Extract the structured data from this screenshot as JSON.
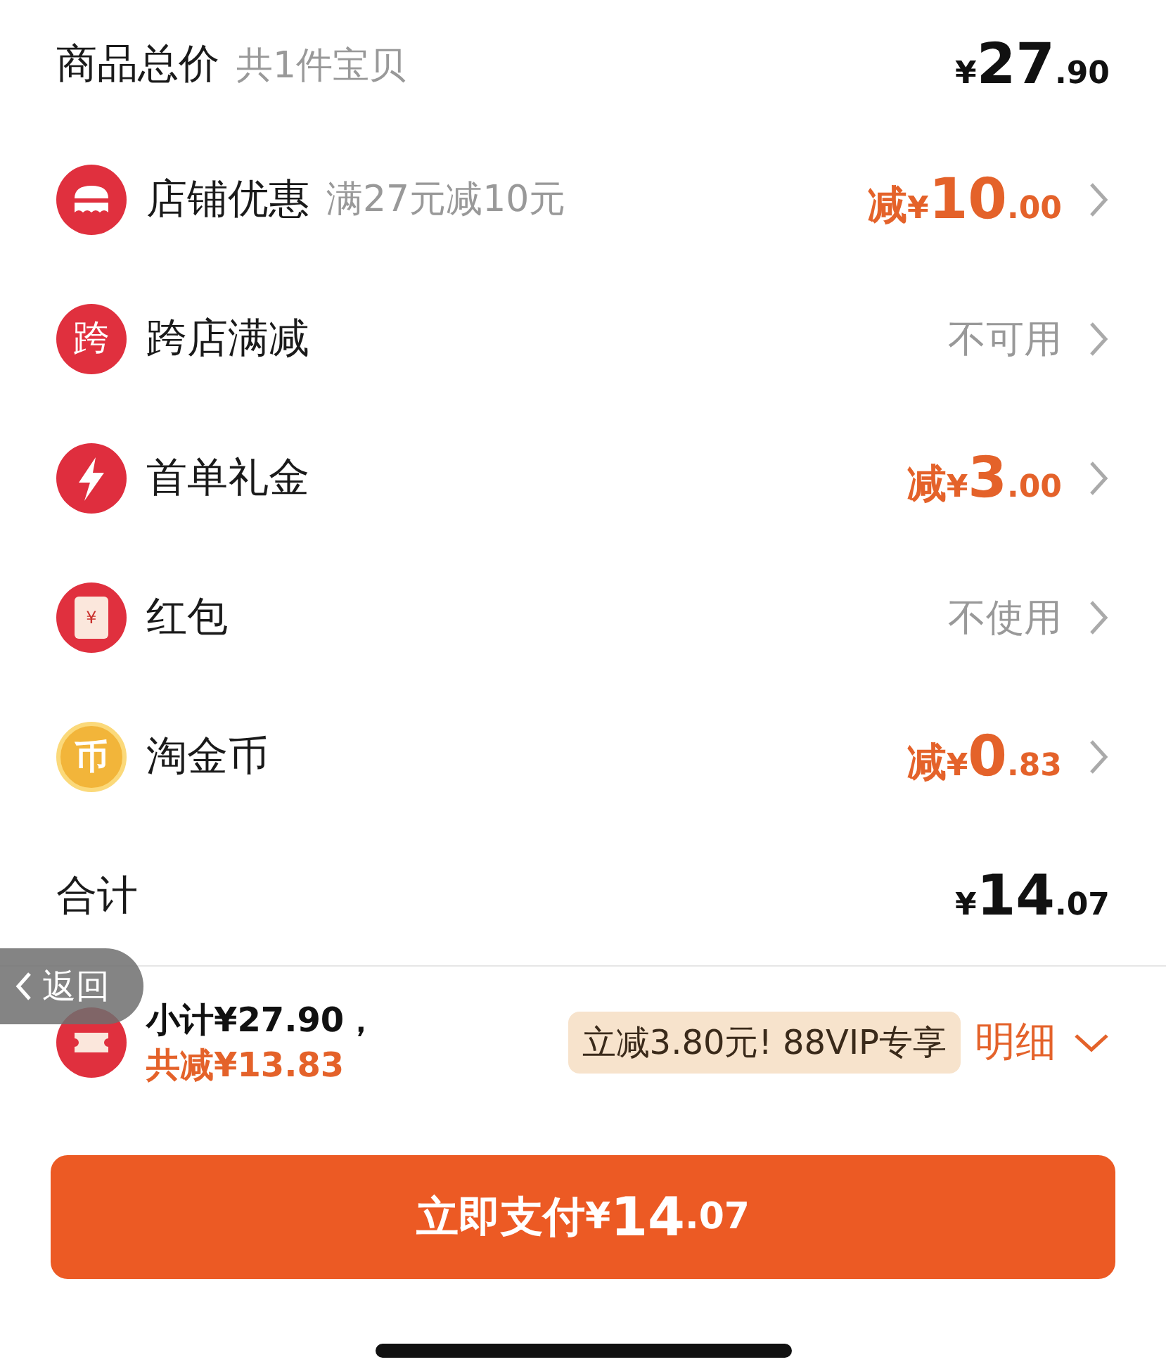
{
  "summary": {
    "label": "商品总价",
    "note": "共1件宝贝",
    "amount": {
      "currency": "¥",
      "integer": "27",
      "decimal": ".90"
    }
  },
  "rows": [
    {
      "icon": {
        "kind": "shop"
      },
      "label": "店铺优惠",
      "note": "满27元减10元",
      "kind": "amount",
      "amount": {
        "prefix": "减",
        "currency": "¥",
        "integer": "10",
        "decimal": ".00"
      }
    },
    {
      "icon": {
        "kind": "glyph",
        "glyph": "跨"
      },
      "label": "跨店满减",
      "kind": "status",
      "status": "不可用"
    },
    {
      "icon": {
        "kind": "bolt"
      },
      "label": "首单礼金",
      "kind": "amount",
      "amount": {
        "prefix": "减",
        "currency": "¥",
        "integer": "3",
        "decimal": ".00"
      }
    },
    {
      "icon": {
        "kind": "envelope",
        "glyph": "¥"
      },
      "label": "红包",
      "kind": "status",
      "status": "不使用"
    },
    {
      "icon": {
        "kind": "coin",
        "glyph": "币"
      },
      "label": "淘金币",
      "kind": "amount",
      "amount": {
        "prefix": "减",
        "currency": "¥",
        "integer": "0",
        "decimal": ".83"
      }
    }
  ],
  "total": {
    "label": "合计",
    "amount": {
      "currency": "¥",
      "integer": "14",
      "decimal": ".07"
    }
  },
  "back_button": {
    "label": "返回"
  },
  "footer": {
    "subtotal": "小计¥27.90，",
    "saved": "共减¥13.83",
    "vip_badge": "立减3.80元! 88VIP专享",
    "details_link": "明细"
  },
  "pay_button": {
    "label": "立即支付",
    "amount": {
      "currency": "¥",
      "integer": "14",
      "decimal": ".07"
    }
  }
}
